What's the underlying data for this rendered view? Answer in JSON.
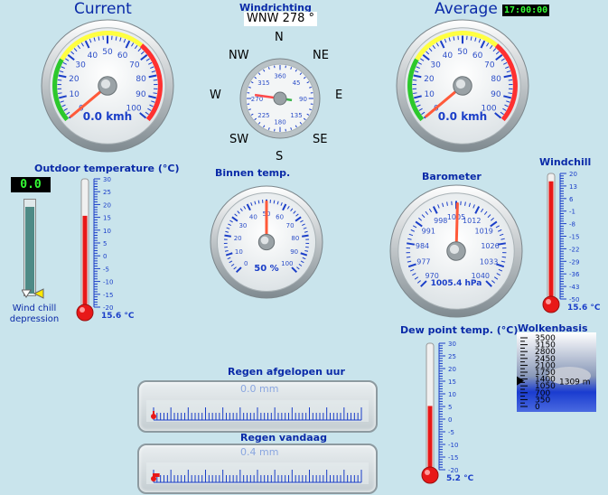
{
  "current": {
    "title": "Current",
    "reading": "0.0 kmh",
    "ticks": [
      "0",
      "10",
      "20",
      "30",
      "40",
      "50",
      "60",
      "70",
      "80",
      "90",
      "100"
    ],
    "value": 0
  },
  "average": {
    "title": "Average",
    "time": "17:00:00",
    "reading": "0.0 kmh",
    "ticks": [
      "0",
      "10",
      "20",
      "30",
      "40",
      "50",
      "60",
      "70",
      "80",
      "90",
      "100"
    ],
    "value": 0
  },
  "wind_direction": {
    "title": "Windrichting",
    "value_text": "WNW 278 °",
    "degrees": 278,
    "ticks": [
      "0",
      "45",
      "90",
      "135",
      "180",
      "225",
      "270",
      "315",
      "360"
    ],
    "compass": {
      "n": "N",
      "ne": "NE",
      "e": "E",
      "se": "SE",
      "s": "S",
      "sw": "SW",
      "w": "W",
      "nw": "NW"
    }
  },
  "indoor_humidity": {
    "title": "Binnen temp.",
    "reading": "50 %",
    "ticks": [
      "0",
      "10",
      "20",
      "30",
      "40",
      "50",
      "60",
      "70",
      "80",
      "90",
      "100"
    ],
    "value": 50
  },
  "barometer": {
    "title": "Barometer",
    "reading": "1005.4 hPa",
    "ticks": [
      "970",
      "977",
      "984",
      "991",
      "998",
      "1005",
      "1012",
      "1019",
      "1026",
      "1033",
      "1040"
    ],
    "value": 1005.4
  },
  "outdoor_temp": {
    "title": "Outdoor temperature (°C)",
    "digital": "0.0",
    "reading": "15.6 °C",
    "ticks": [
      "30",
      "25",
      "20",
      "15",
      "10",
      "5",
      "0",
      "-5",
      "-10",
      "-15",
      "-20"
    ],
    "value": 15.6,
    "min": -20,
    "max": 30
  },
  "wind_chill_depression": {
    "label_line1": "Wind chill",
    "label_line2": "depression"
  },
  "windchill": {
    "title": "Windchill",
    "reading": "15.6 °C",
    "ticks": [
      "20",
      "13",
      "6",
      "-1",
      "-8",
      "-15",
      "-22",
      "-29",
      "-36",
      "-43",
      "-50"
    ],
    "value": 15.6,
    "min": -50,
    "max": 20
  },
  "dew_point": {
    "title": "Dew point temp. (°C)",
    "reading": "5.2 °C",
    "ticks": [
      "30",
      "25",
      "20",
      "15",
      "10",
      "5",
      "0",
      "-5",
      "-10",
      "-15",
      "-20"
    ],
    "value": 5.2,
    "min": -20,
    "max": 30
  },
  "cloud_base": {
    "title": "Wolkenbasis",
    "reading": "1309 m",
    "ticks": [
      "3500",
      "3150",
      "2800",
      "2450",
      "2100",
      "1750",
      "1400",
      "1050",
      "700",
      "350",
      "0"
    ],
    "value": 1309
  },
  "rain_hour": {
    "title": "Regen afgelopen uur",
    "reading": "0.0 mm",
    "value": 0
  },
  "rain_today": {
    "title": "Regen vandaag",
    "reading": "0.4 mm",
    "value": 0.4
  }
}
